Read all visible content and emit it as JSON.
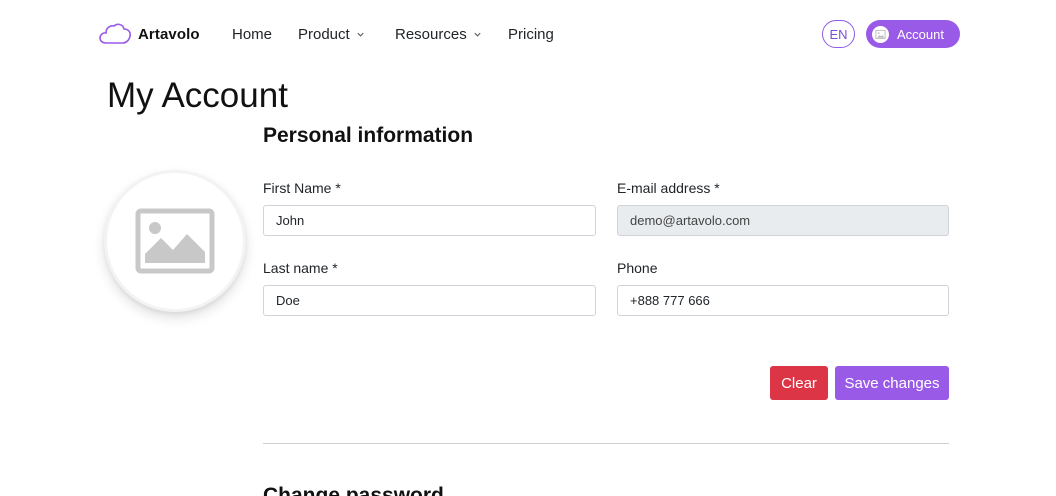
{
  "nav": {
    "brand": "Artavolo",
    "links": [
      {
        "label": "Home"
      },
      {
        "label": "Product"
      },
      {
        "label": "Resources"
      },
      {
        "label": "Pricing"
      }
    ],
    "lang": "EN",
    "account_label": "Account"
  },
  "page": {
    "title": "My Account"
  },
  "personal": {
    "title": "Personal information",
    "first_name": {
      "label": "First Name *",
      "value": "John"
    },
    "email": {
      "label": "E-mail address *",
      "value": "demo@artavolo.com"
    },
    "last_name": {
      "label": "Last name *",
      "value": "Doe"
    },
    "phone": {
      "label": "Phone",
      "value": "+888 777 666"
    },
    "clear_label": "Clear",
    "save_label": "Save changes"
  },
  "password": {
    "title": "Change password"
  },
  "colors": {
    "accent": "#9a5ae8",
    "danger": "#dc3545"
  }
}
